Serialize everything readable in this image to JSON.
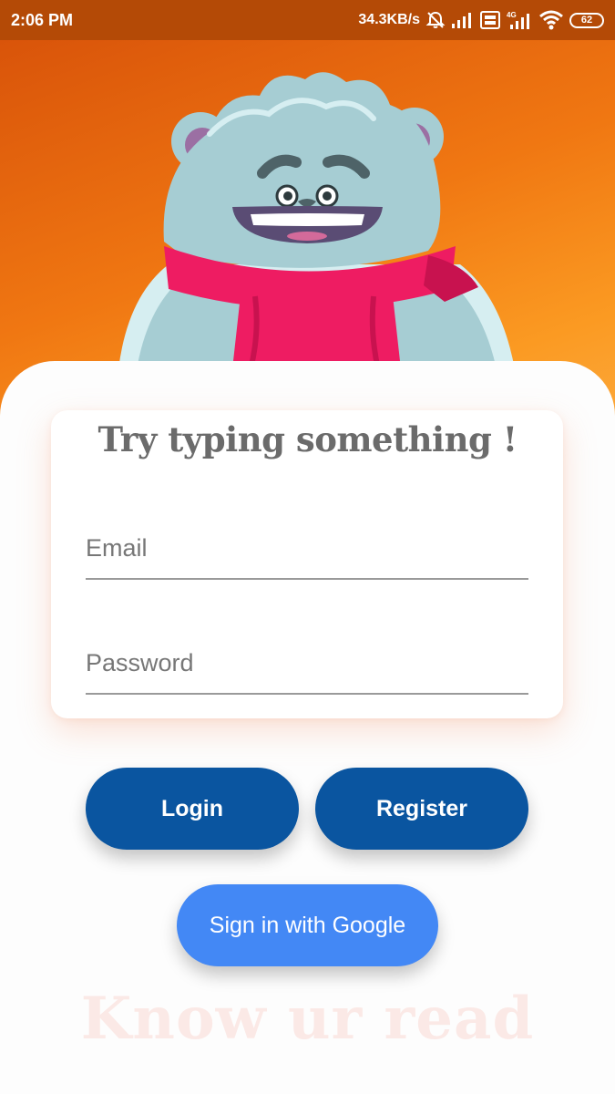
{
  "status_bar": {
    "time": "2:06 PM",
    "network_speed": "34.3KB/s",
    "battery": "62",
    "icons": [
      "alarm-off-icon",
      "signal-icon",
      "volte-icon",
      "4g-signal-icon",
      "wifi-icon",
      "battery-icon"
    ]
  },
  "form": {
    "title": "Try typing something !",
    "email_placeholder": "Email",
    "password_placeholder": "Password"
  },
  "buttons": {
    "login": "Login",
    "register": "Register",
    "google": "Sign in with Google"
  },
  "footer": {
    "brand": "Know ur read"
  },
  "colors": {
    "status_bar": "#b44a06",
    "hero_gradient_start": "#d9540a",
    "hero_gradient_end": "#fcae45",
    "primary_button": "#0a55a0",
    "google_button": "#4388f5",
    "title_text": "#6b6b6b",
    "mascot_fur": "#a6cdd3",
    "mascot_scarf": "#ee1c62"
  }
}
